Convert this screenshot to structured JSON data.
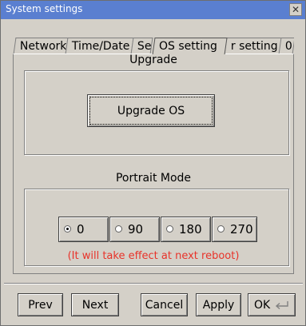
{
  "window": {
    "title": "System settings",
    "close_glyph": "✕"
  },
  "tabs": [
    {
      "label": "Network",
      "active": false
    },
    {
      "label": "Time/Date",
      "active": false
    },
    {
      "label": "Se",
      "active": false
    },
    {
      "label": "OS setting",
      "active": true
    },
    {
      "label": "r setting",
      "active": false
    },
    {
      "label": "0",
      "active": false
    }
  ],
  "upgrade": {
    "group_title": "Upgrade",
    "button_label": "Upgrade OS"
  },
  "portrait": {
    "group_title": "Portrait Mode",
    "options": [
      {
        "label": "0",
        "selected": true
      },
      {
        "label": "90",
        "selected": false
      },
      {
        "label": "180",
        "selected": false
      },
      {
        "label": "270",
        "selected": false
      }
    ],
    "notice": "(It will take effect at next reboot)",
    "notice_color": "#e8332a"
  },
  "footer": {
    "prev_label": "Prev",
    "next_label": "Next",
    "cancel_label": "Cancel",
    "apply_label": "Apply",
    "ok_label": "OK",
    "ok_icon": "enter-icon"
  },
  "colors": {
    "titlebar": "#5a7fd0",
    "window_bg": "#d4d0c8"
  }
}
